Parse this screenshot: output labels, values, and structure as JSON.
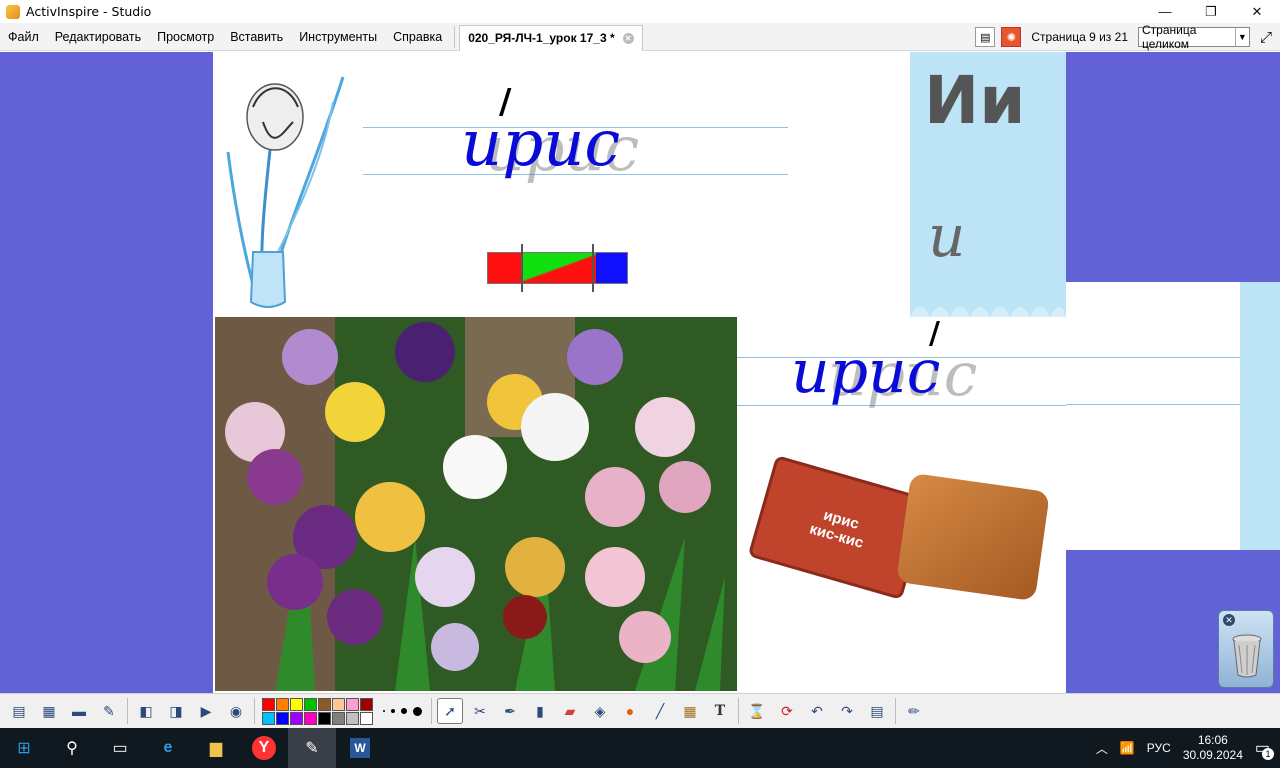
{
  "window": {
    "title": "ActivInspire - Studio",
    "minimize": "—",
    "restore": "❐",
    "close": "✕"
  },
  "menu": [
    {
      "label": "Файл"
    },
    {
      "label": "Редактировать"
    },
    {
      "label": "Просмотр"
    },
    {
      "label": "Вставить"
    },
    {
      "label": "Инструменты"
    },
    {
      "label": "Справка"
    }
  ],
  "doc_tab": {
    "label": "020_РЯ-ЛЧ-1_урок 17_3 *"
  },
  "pager": {
    "text": "Страница 9 из 21",
    "zoom": "Страница целиком"
  },
  "slide": {
    "word_top": "ирис",
    "stress_mark": "/",
    "letter_caps": "Ии",
    "letter_small": "и",
    "word_right": "ирис",
    "candy_text_top": "ирис",
    "candy_text_bottom": "кис-кис",
    "scheme_colors": {
      "red": "#ff1010",
      "green": "#10e010",
      "blue": "#1010ff"
    }
  },
  "toolbar": {
    "palette": [
      "#ff0000",
      "#ff8000",
      "#ffff00",
      "#00c000",
      "#8b5a2b",
      "#ffc890",
      "#ff9ed2",
      "#a00000",
      "#00c0ff",
      "#0000ff",
      "#a000ff",
      "#ff00c0",
      "#000000",
      "#808080",
      "#c0c0c0",
      "#ffffff"
    ],
    "text_tool": "T"
  },
  "taskbar": {
    "lang": "РУС",
    "time": "16:06",
    "date": "30.09.2024",
    "notif_count": "1"
  }
}
